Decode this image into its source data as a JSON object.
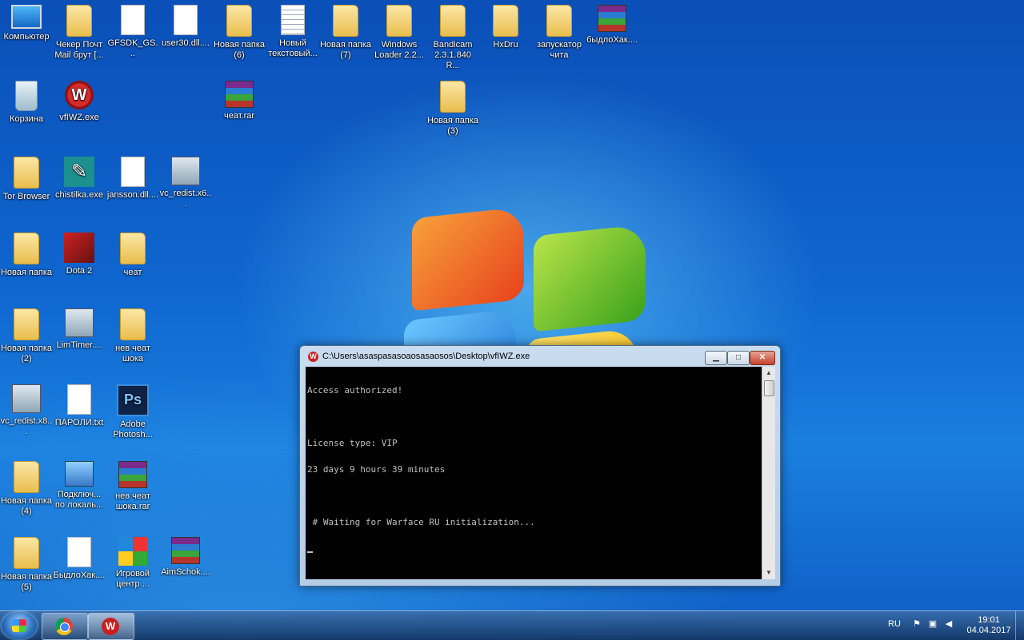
{
  "desktop": {
    "icons": [
      {
        "label": "Компьютер",
        "icon": "computer-icon"
      },
      {
        "label": "Чекер Почт Mail брут [...",
        "icon": "folder-icon"
      },
      {
        "label": "GFSDK_GS...",
        "icon": "file-icon"
      },
      {
        "label": "user30.dll....",
        "icon": "file-icon"
      },
      {
        "label": "Новая папка (6)",
        "icon": "folder-icon"
      },
      {
        "label": "Новый текстовый...",
        "icon": "text-file-icon"
      },
      {
        "label": "Новая папка (7)",
        "icon": "folder-icon"
      },
      {
        "label": "Windows Loader 2.2...",
        "icon": "folder-icon"
      },
      {
        "label": "Bandicam 2.3.1.840 R...",
        "icon": "folder-icon"
      },
      {
        "label": "HxDru",
        "icon": "folder-icon"
      },
      {
        "label": "запускатор чита",
        "icon": "folder-icon"
      },
      {
        "label": "быдлоХак....",
        "icon": "rar-archive-icon"
      },
      {
        "label": "Корзина",
        "icon": "recycle-bin-icon"
      },
      {
        "label": "vfIWZ.exe",
        "icon": "vfiwz-app-icon"
      },
      {
        "label": "чеат.rar",
        "icon": "rar-archive-icon"
      },
      {
        "label": "Новая папка (3)",
        "icon": "folder-icon"
      },
      {
        "label": "Tor Browser",
        "icon": "folder-icon"
      },
      {
        "label": "chistilka.exe",
        "icon": "brush-app-icon"
      },
      {
        "label": "jansson.dll....",
        "icon": "file-icon"
      },
      {
        "label": "vc_redist.x6...",
        "icon": "setup-icon"
      },
      {
        "label": "Новая папка",
        "icon": "folder-icon"
      },
      {
        "label": "Dota 2",
        "icon": "dota2-icon"
      },
      {
        "label": "чеат",
        "icon": "folder-icon"
      },
      {
        "label": "Новая папка (2)",
        "icon": "folder-icon"
      },
      {
        "label": "LimTimer....",
        "icon": "setup-icon"
      },
      {
        "label": "нев чеат шока",
        "icon": "folder-icon"
      },
      {
        "label": "vc_redist.x8...",
        "icon": "setup-icon"
      },
      {
        "label": "ПАРОЛИ.txt",
        "icon": "file-icon"
      },
      {
        "label": "Adobe Photosh...",
        "icon": "photoshop-icon"
      },
      {
        "label": "Новая папка (4)",
        "icon": "folder-icon"
      },
      {
        "label": "Подключ... по локаль...",
        "icon": "network-icon"
      },
      {
        "label": "нев чеат шока.rar",
        "icon": "rar-archive-icon"
      },
      {
        "label": "Новая папка (5)",
        "icon": "folder-icon"
      },
      {
        "label": "БыдлоХак....",
        "icon": "file-icon"
      },
      {
        "label": "Игровой центр ...",
        "icon": "game-center-icon"
      },
      {
        "label": "AimSchok....",
        "icon": "rar-archive-icon"
      }
    ]
  },
  "console_window": {
    "title": "C:\\Users\\asaspasasoaosasaosos\\Desktop\\vfIWZ.exe",
    "minimize": "▁",
    "maximize": "□",
    "close": "✕",
    "lines": [
      "Access authorized!",
      "",
      "License type: VIP",
      "23 days 9 hours 39 minutes",
      "",
      " # Waiting for Warface RU initialization...",
      ""
    ]
  },
  "taskbar": {
    "pinned": [
      "chrome-icon",
      "vfiwz-app-icon"
    ],
    "tray": {
      "language": "RU",
      "time": "19:01",
      "date": "04.04.2017"
    }
  }
}
